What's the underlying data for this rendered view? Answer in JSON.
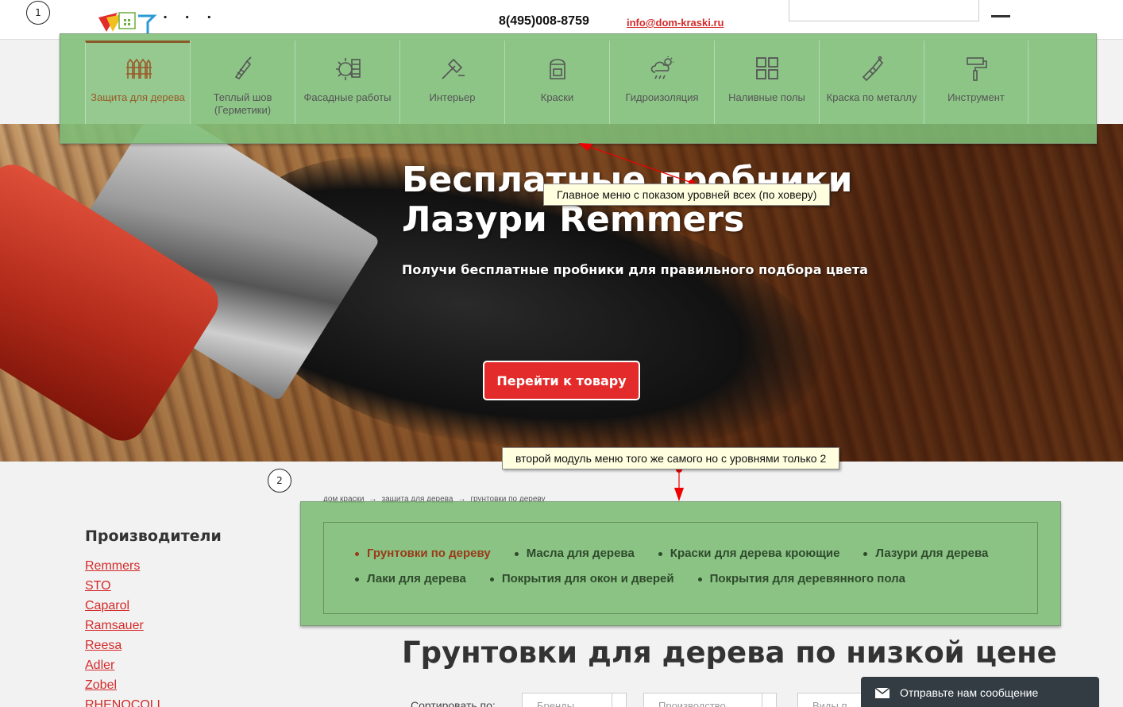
{
  "header": {
    "circle_1": "1",
    "phone": "8(495)008-8759",
    "email": "info@dom-kraski.ru"
  },
  "main_menu": {
    "items": [
      {
        "label": "Защита для дерева",
        "icon": "fence-icon"
      },
      {
        "label": "Теплый шов (Герметики)",
        "icon": "sealant-gun-icon"
      },
      {
        "label": "Фасадные работы",
        "icon": "facade-icon"
      },
      {
        "label": "Интерьер",
        "icon": "interior-brush-icon"
      },
      {
        "label": "Краски",
        "icon": "paint-bucket-icon"
      },
      {
        "label": "Гидроизоляция",
        "icon": "weather-icon"
      },
      {
        "label": "Наливные полы",
        "icon": "grid-tiles-icon"
      },
      {
        "label": "Краска по металлу",
        "icon": "spray-paint-icon"
      },
      {
        "label": "Инструмент",
        "icon": "paint-roller-icon"
      }
    ],
    "active_index": 0
  },
  "hero": {
    "title": "Бесплатные пробники Лазури Remmers",
    "subtitle": "Получи бесплатные пробники для правильного подбора цвета",
    "button": "Перейти к товару"
  },
  "annotations": {
    "tooltip_main": "Главное меню с показом уровней всех (по ховеру)",
    "tooltip_sub": "второй модуль меню того же самого но с уровнями только 2",
    "circle_2": "2"
  },
  "breadcrumb": {
    "items": [
      "дом краски",
      "защита для дерева",
      "грунтовки по дереву"
    ],
    "separator": "→"
  },
  "submenu": {
    "items": [
      "Грунтовки по дереву",
      "Масла для дерева",
      "Краски для дерева кроющие",
      "Лазури для дерева",
      "Лаки для дерева",
      "Покрытия для окон и дверей",
      "Покрытия для деревянного пола"
    ],
    "active_index": 0
  },
  "sidebar": {
    "title": "Производители",
    "manufacturers": [
      "Remmers",
      "STO",
      "Caparol",
      "Ramsauer",
      "Reesa",
      "Adler",
      "Zobel",
      "RHENOCOLL"
    ]
  },
  "page_title": "Грунтовки для дерева по низкой цене",
  "sort": {
    "label": "Сортировать по:",
    "selects": [
      "Бренды",
      "Производство",
      "Виды п"
    ]
  },
  "chat": {
    "label": "Отправьте нам сообщение"
  },
  "colors": {
    "accent_red": "#d42a2a",
    "button_red": "#e32b2b",
    "overlay_green": "#7ebe78",
    "active_brown": "#9a5a2a"
  }
}
